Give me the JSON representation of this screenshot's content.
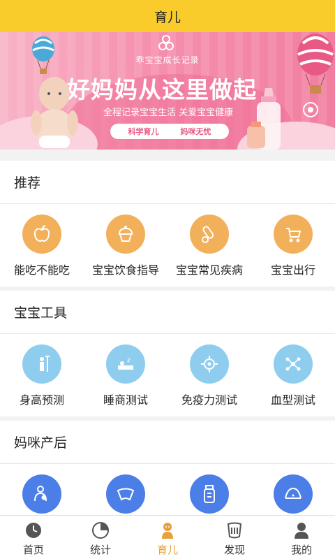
{
  "header": {
    "title": "育儿"
  },
  "banner": {
    "small_title": "乖宝宝成长记录",
    "headline": "好妈妈从这里做起",
    "tagline": "全程记录宝宝生活 关爱宝宝健康",
    "chips": [
      "科学育儿",
      "妈咪无忧"
    ]
  },
  "sections": [
    {
      "title": "推荐",
      "items": [
        {
          "label": "能吃不能吃",
          "icon": "apple-icon"
        },
        {
          "label": "宝宝饮食指导",
          "icon": "cupcake-icon"
        },
        {
          "label": "宝宝常见疾病",
          "icon": "thermometer-icon"
        },
        {
          "label": "宝宝出行",
          "icon": "stroller-icon"
        }
      ]
    },
    {
      "title": "宝宝工具",
      "items": [
        {
          "label": "身高预测",
          "icon": "height-icon"
        },
        {
          "label": "睡商测试",
          "icon": "sleep-icon"
        },
        {
          "label": "免疫力测试",
          "icon": "virus-icon"
        },
        {
          "label": "血型测试",
          "icon": "molecule-icon"
        }
      ]
    },
    {
      "title": "妈咪产后",
      "items": [
        {
          "label": "",
          "icon": "mother-baby-icon"
        },
        {
          "label": "",
          "icon": "pelvis-icon"
        },
        {
          "label": "",
          "icon": "baby-bottle-icon"
        },
        {
          "label": "",
          "icon": "postpartum-icon"
        }
      ]
    }
  ],
  "tabs": [
    {
      "label": "首页",
      "icon": "clock-icon",
      "active": false
    },
    {
      "label": "统计",
      "icon": "pie-chart-icon",
      "active": false
    },
    {
      "label": "育儿",
      "icon": "baby-icon",
      "active": true
    },
    {
      "label": "发现",
      "icon": "discover-icon",
      "active": false
    },
    {
      "label": "我的",
      "icon": "user-icon",
      "active": false
    }
  ],
  "colors": {
    "header": "#f9cc2c",
    "recommend_icon": "#f2b05a",
    "tools_icon": "#8fcdee",
    "mom_icon": "#4c7ee8",
    "active_tab": "#e8a13a"
  }
}
